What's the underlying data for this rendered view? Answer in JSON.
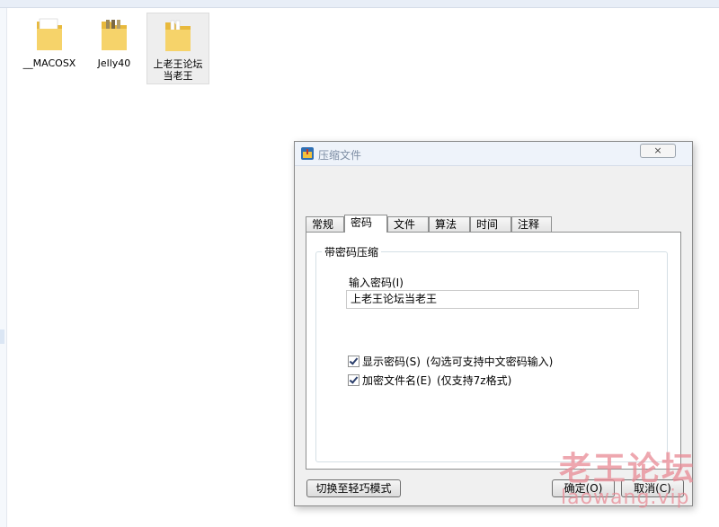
{
  "desktop": {
    "items": [
      {
        "name": "__MACOSX"
      },
      {
        "name": "Jelly40"
      },
      {
        "name": "上老王论坛\n当老王"
      }
    ]
  },
  "dialog": {
    "title": "压缩文件",
    "close_label": "×",
    "tabs": [
      {
        "label": "常规"
      },
      {
        "label": "密码"
      },
      {
        "label": "文件"
      },
      {
        "label": "算法"
      },
      {
        "label": "时间"
      },
      {
        "label": "注释"
      }
    ],
    "active_tab": "密码",
    "group_label": "带密码压缩",
    "password_label": "输入密码(I)",
    "password_value": "上老王论坛当老王",
    "show_password": {
      "label": "显示密码(S)",
      "hint": "(勾选可支持中文密码输入)",
      "checked": true
    },
    "encrypt_names": {
      "label": "加密文件名(E)",
      "hint": "(仅支持7z格式)",
      "checked": true
    },
    "buttons": {
      "switch_mode": "切换至轻巧模式",
      "ok": "确定(O)",
      "cancel": "取消(C)"
    }
  },
  "watermark": {
    "cn": "老王论坛",
    "en": "laowang.vip"
  },
  "colors": {
    "folder": "#f2c94c",
    "watermark": "#e98a95",
    "accent": "#2b3e6b"
  }
}
